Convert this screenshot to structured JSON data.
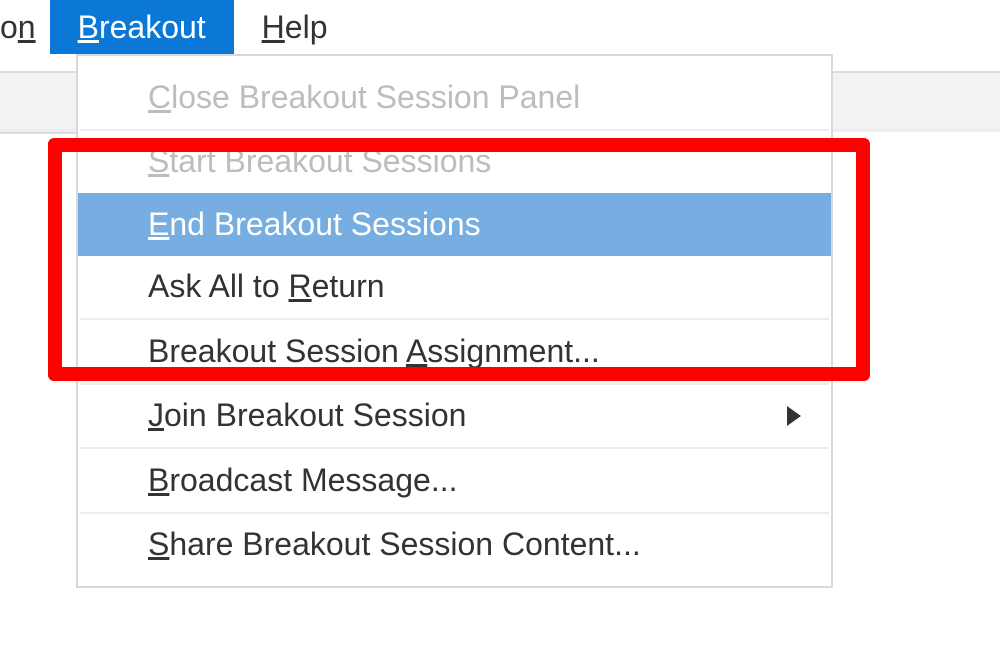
{
  "menubar": {
    "partial_prev": {
      "prefix": "o",
      "mnemonic": "n"
    },
    "breakout": {
      "mnemonic": "B",
      "rest": "reakout"
    },
    "help": {
      "mnemonic": "H",
      "rest": "elp"
    }
  },
  "dropdown": {
    "close_panel": {
      "mnemonic": "C",
      "rest": "lose Breakout Session Panel"
    },
    "start": {
      "mnemonic": "S",
      "rest": "tart Breakout Sessions"
    },
    "end": {
      "mnemonic": "E",
      "rest": "nd Breakout Sessions"
    },
    "ask_return": {
      "prefix": "Ask All to ",
      "mnemonic": "R",
      "rest": "eturn"
    },
    "assignment": {
      "prefix": "Breakout Session ",
      "mnemonic": "A",
      "rest": "ssignment..."
    },
    "join": {
      "mnemonic": "J",
      "rest": "oin Breakout Session"
    },
    "broadcast": {
      "mnemonic": "B",
      "rest": "roadcast Message..."
    },
    "share_content": {
      "mnemonic": "S",
      "rest": "hare Breakout Session Content..."
    }
  }
}
